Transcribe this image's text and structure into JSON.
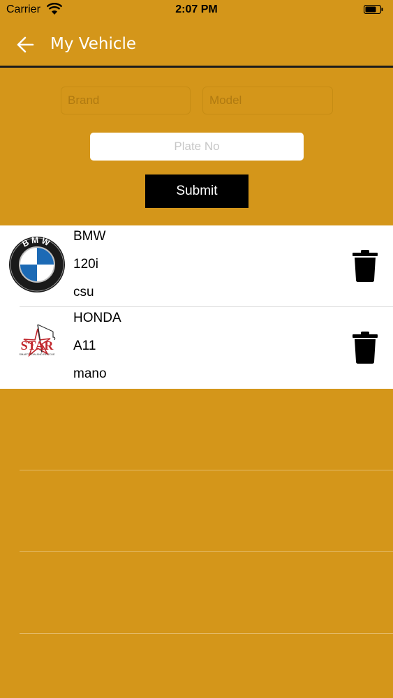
{
  "status_bar": {
    "carrier": "Carrier",
    "time": "2:07 PM"
  },
  "nav": {
    "title": "My Vehicle",
    "back_icon": "arrow-left-icon"
  },
  "form": {
    "brand_placeholder": "Brand",
    "model_placeholder": "Model",
    "plate_placeholder": "Plate No",
    "submit_label": "Submit"
  },
  "vehicles": [
    {
      "brand": "BMW",
      "model": "120i",
      "plate": "csu",
      "logo": "bmw-logo"
    },
    {
      "brand": "HONDA",
      "model": "A11",
      "plate": "mano",
      "logo": "star-logo"
    }
  ],
  "logo_text": {
    "star": "STAR",
    "star_tagline": "SMART TOW AND RESCUE",
    "bmw": "BMW"
  },
  "colors": {
    "background": "#D4961A",
    "button": "#000000",
    "row": "#FFFFFF"
  }
}
